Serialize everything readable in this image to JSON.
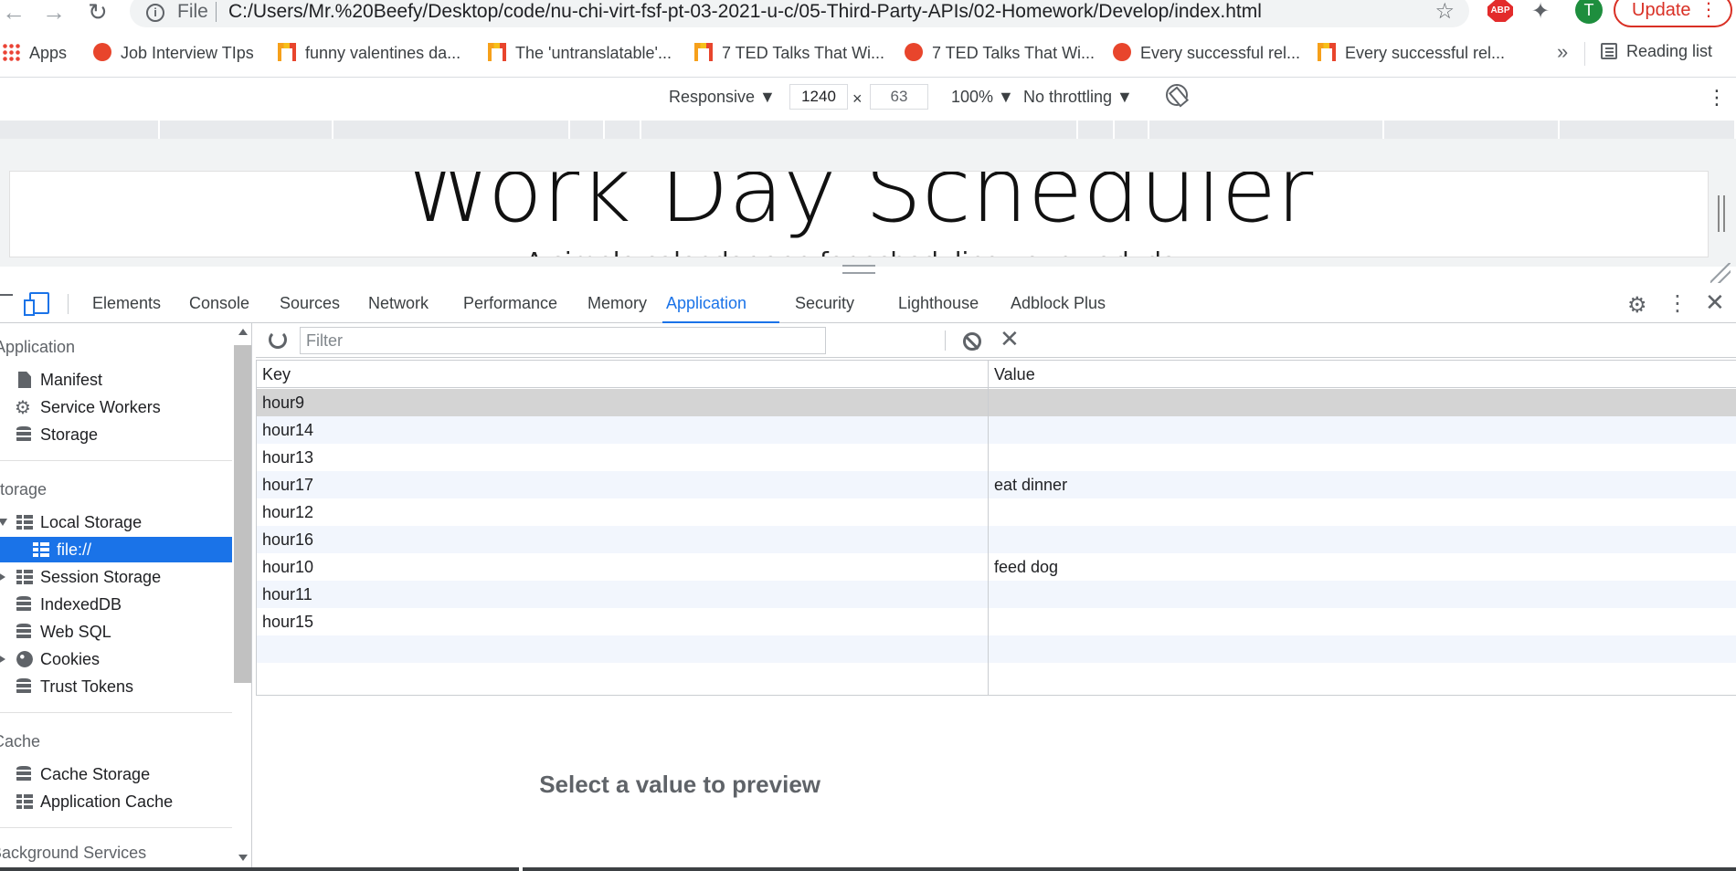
{
  "browser": {
    "file_label": "File",
    "url": "C:/Users/Mr.%20Beefy/Desktop/code/nu-chi-virt-fsf-pt-03-2021-u-c/05-Third-Party-APIs/02-Homework/Develop/index.html",
    "abp_label": "ABP",
    "profile_initial": "T",
    "update_label": "Update"
  },
  "bookmarks": {
    "apps": "Apps",
    "items": [
      {
        "label": "Job Interview TIps",
        "icon": "red-circle-icon"
      },
      {
        "label": "funny valentines da...",
        "icon": "orange-m-icon"
      },
      {
        "label": "The 'untranslatable'...",
        "icon": "orange-m-icon"
      },
      {
        "label": "7 TED Talks That Wi...",
        "icon": "orange-m-icon"
      },
      {
        "label": "7 TED Talks That Wi...",
        "icon": "red-circle-icon"
      },
      {
        "label": "Every successful rel...",
        "icon": "red-circle-icon"
      },
      {
        "label": "Every successful rel...",
        "icon": "orange-m-icon"
      }
    ],
    "more": "»",
    "reading_list": "Reading list"
  },
  "device_toolbar": {
    "mode": "Responsive ▼",
    "width": "1240",
    "height": "63",
    "times": "×",
    "zoom": "100% ▼",
    "throttle": "No throttling ▼"
  },
  "viewport_page": {
    "title": "Work Day Scheduler",
    "subtitle": "A simple calendar app for scheduling your work day"
  },
  "devtools": {
    "tabs": [
      "Elements",
      "Console",
      "Sources",
      "Network",
      "Performance",
      "Memory",
      "Application",
      "Security",
      "Lighthouse",
      "Adblock Plus"
    ],
    "active_tab": "Application"
  },
  "sidebar": {
    "sections": {
      "application": "Application",
      "storage": "Storage",
      "cache": "Cache",
      "background": "Background Services"
    },
    "application_items": [
      "Manifest",
      "Service Workers",
      "Storage"
    ],
    "storage_items": [
      "Local Storage",
      "file://",
      "Session Storage",
      "IndexedDB",
      "Web SQL",
      "Cookies",
      "Trust Tokens"
    ],
    "cache_items": [
      "Cache Storage",
      "Application Cache"
    ]
  },
  "storage_toolbar": {
    "filter_placeholder": "Filter"
  },
  "table": {
    "headers": [
      "Key",
      "Value"
    ],
    "rows": [
      {
        "key": "hour9",
        "value": ""
      },
      {
        "key": "hour14",
        "value": ""
      },
      {
        "key": "hour13",
        "value": ""
      },
      {
        "key": "hour17",
        "value": "eat dinner"
      },
      {
        "key": "hour12",
        "value": ""
      },
      {
        "key": "hour16",
        "value": ""
      },
      {
        "key": "hour10",
        "value": "feed dog"
      },
      {
        "key": "hour11",
        "value": ""
      },
      {
        "key": "hour15",
        "value": ""
      }
    ]
  },
  "preview": {
    "text": "Select a value to preview"
  },
  "colors": {
    "accent": "#1a73e8",
    "selected_row": "#d4d4d4",
    "striped_row": "#f2f6fd",
    "update_red": "#d93025"
  }
}
